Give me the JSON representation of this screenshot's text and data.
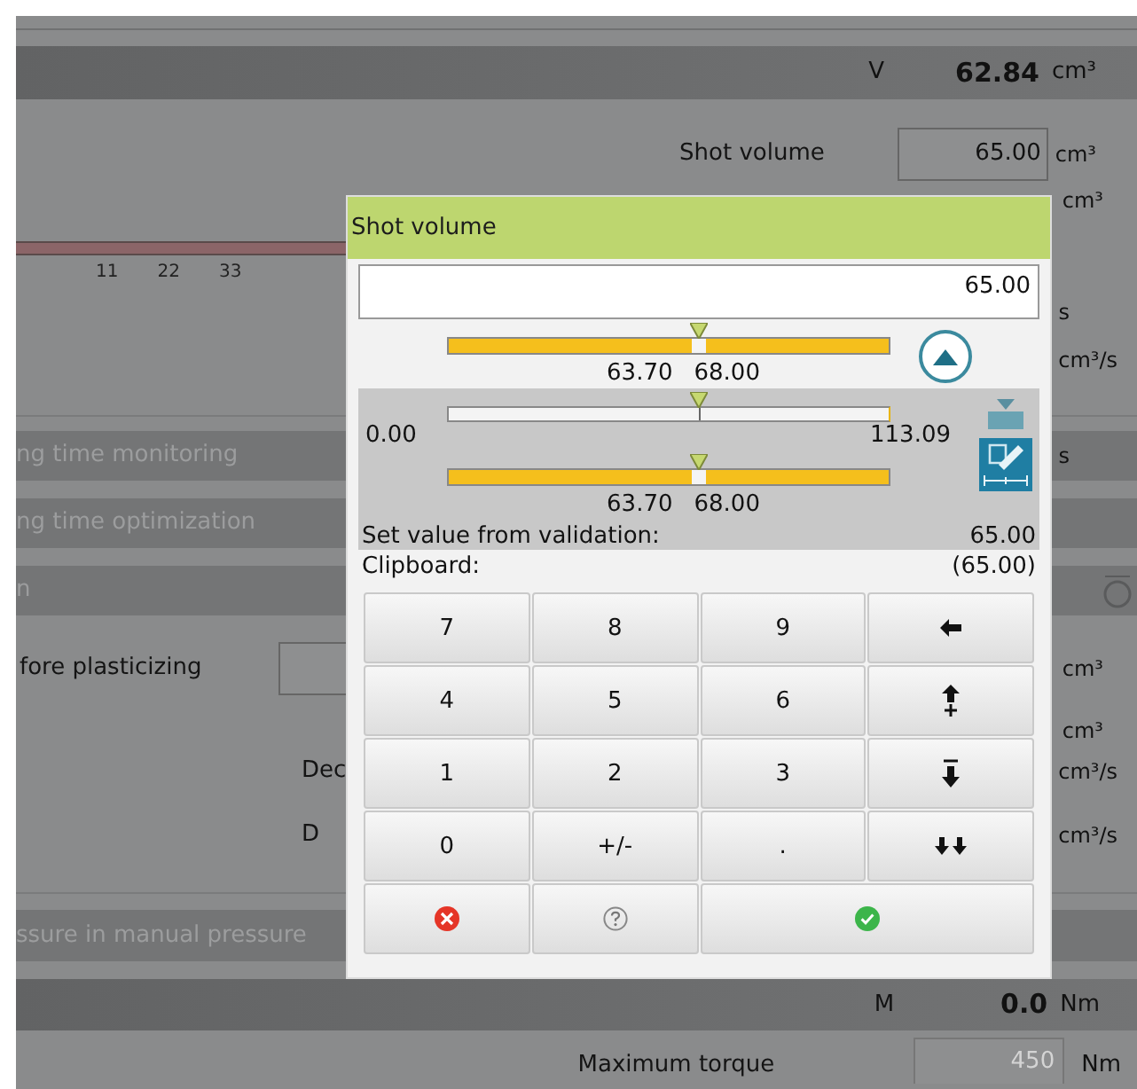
{
  "background": {
    "top_bar": {
      "symbol": "V",
      "value": "62.84",
      "unit": "cm³"
    },
    "shot_volume": {
      "label": "Shot volume",
      "value": "65.00",
      "unit": "cm³"
    },
    "unit_below_shot": "cm³",
    "axis_ticks": [
      "11",
      "22",
      "33"
    ],
    "unit_s": "s",
    "unit_rate": "cm³/s",
    "sections": [
      {
        "label": "ng time monitoring",
        "unit": "s"
      },
      {
        "label": "ng time optimization"
      },
      {
        "label": "n",
        "kind": "toggle"
      }
    ],
    "plasticizing": {
      "label": "fore plasticizing",
      "unit": "cm³"
    },
    "unit_mid": "cm³",
    "rows": [
      {
        "label": "Dec",
        "unit": "cm³/s"
      },
      {
        "label": "D",
        "unit": "cm³/s"
      }
    ],
    "manual_pressure": "ssure in manual pressure",
    "torque_bar": {
      "symbol": "M",
      "value": "0.0",
      "unit": "Nm"
    },
    "max_torque": {
      "label": "Maximum torque",
      "value": "450",
      "unit": "Nm"
    }
  },
  "dialog": {
    "title": "Shot volume",
    "value": "65.00",
    "tolerance_slider": {
      "level": 0.57,
      "low": "63.70",
      "high": "68.00"
    },
    "range_slider": {
      "level": 0.57,
      "min": "0.00",
      "max": "113.09"
    },
    "validation_slider": {
      "level": 0.57,
      "low": "63.70",
      "high": "68.00"
    },
    "validation_label": "Set value from validation:",
    "validation_value": "65.00",
    "clipboard_label": "Clipboard:",
    "clipboard_value": "(65.00)",
    "keys": [
      {
        "kind": "text",
        "label": "7"
      },
      {
        "kind": "text",
        "label": "8"
      },
      {
        "kind": "text",
        "label": "9"
      },
      {
        "kind": "backspace"
      },
      {
        "kind": "text",
        "label": "4"
      },
      {
        "kind": "text",
        "label": "5"
      },
      {
        "kind": "text",
        "label": "6"
      },
      {
        "kind": "increment"
      },
      {
        "kind": "text",
        "label": "1"
      },
      {
        "kind": "text",
        "label": "2"
      },
      {
        "kind": "text",
        "label": "3"
      },
      {
        "kind": "decrement"
      },
      {
        "kind": "text",
        "label": "0"
      },
      {
        "kind": "text",
        "label": "+/-"
      },
      {
        "kind": "text",
        "label": "."
      },
      {
        "kind": "step_down"
      },
      {
        "kind": "cancel"
      },
      {
        "kind": "help"
      },
      {
        "kind": "confirm"
      }
    ]
  }
}
